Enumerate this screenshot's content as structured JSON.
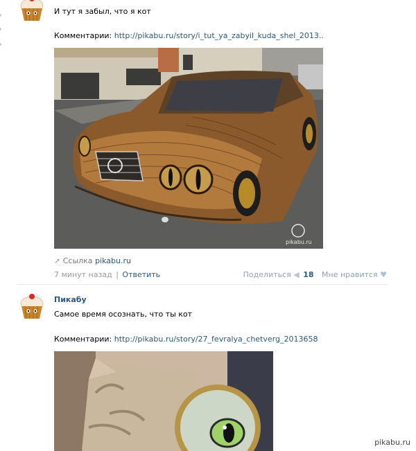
{
  "posts": [
    {
      "text": "И тут я забыл, что я кот",
      "comment_label": "Комментарии:",
      "comment_link": "http://pikabu.ru/story/i_tut_ya_zabyil_kuda_shel_2013..",
      "photo_watermark": "pikabu.ru",
      "link_prefix": "Ссылка",
      "link_domain": "pikabu.ru",
      "time": "7 минут назад",
      "separator": "|",
      "reply": "Ответить",
      "share_label": "Поделиться",
      "share_count": "18",
      "like_label": "Мне нравится"
    },
    {
      "author": "Пикабу",
      "text": "Самое время осознать, что ты кот",
      "comment_label": "Комментарии:",
      "comment_link": "http://pikabu.ru/story/27_fevralya_chetverg_2013658"
    }
  ],
  "watermark": "pikabu.ru",
  "colors": {
    "link": "#2b587a",
    "muted": "#999999",
    "divider": "#e3e7ec",
    "like_heart": "#aac3dd"
  },
  "icons": [
    "cupcake-avatar-icon",
    "pin-icon",
    "share-arrow-icon",
    "heart-icon"
  ]
}
